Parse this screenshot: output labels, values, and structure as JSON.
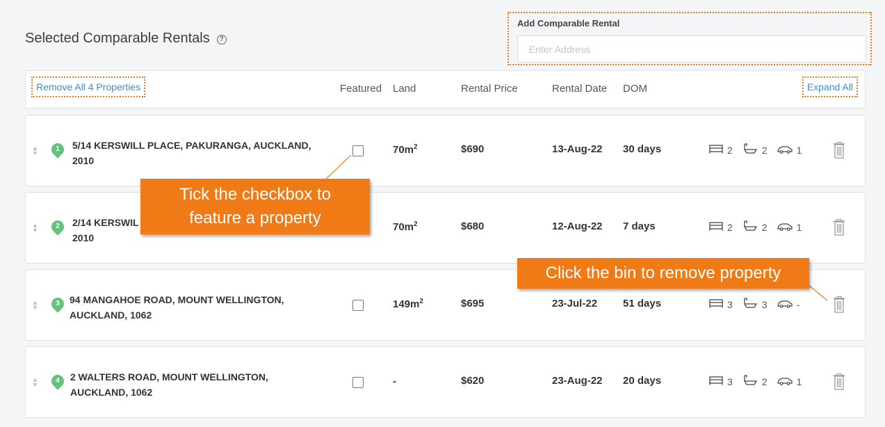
{
  "title": "Selected Comparable Rentals",
  "add_rental": {
    "label": "Add Comparable Rental",
    "placeholder": "Enter Address"
  },
  "header": {
    "remove_all_label": "Remove All 4 Properties",
    "expand_all_label": "Expand All",
    "columns": {
      "featured": "Featured",
      "land": "Land",
      "price": "Rental Price",
      "date": "Rental Date",
      "dom": "DOM"
    }
  },
  "properties": [
    {
      "num": "1",
      "address_line1": "5/14 KERSWILL PLACE, PAKURANGA, AUCKLAND,",
      "address_line2": "2010",
      "land": "70m",
      "land_sup": "2",
      "price": "$690",
      "date": "13-Aug-22",
      "dom": "30 days",
      "beds": "2",
      "baths": "2",
      "cars": "1"
    },
    {
      "num": "2",
      "address_line1": "2/14 KERSWIL",
      "address_line2": "2010",
      "land": "70m",
      "land_sup": "2",
      "price": "$680",
      "date": "12-Aug-22",
      "dom": "7 days",
      "beds": "2",
      "baths": "2",
      "cars": "1"
    },
    {
      "num": "3",
      "address_line1": "94 MANGAHOE ROAD, MOUNT WELLINGTON,",
      "address_line2": "AUCKLAND, 1062",
      "land": "149m",
      "land_sup": "2",
      "price": "$695",
      "date": "23-Jul-22",
      "dom": "51 days",
      "beds": "3",
      "baths": "3",
      "cars": "-"
    },
    {
      "num": "4",
      "address_line1": "2 WALTERS ROAD, MOUNT WELLINGTON,",
      "address_line2": "AUCKLAND, 1062",
      "land": "-",
      "land_sup": "",
      "price": "$620",
      "date": "23-Aug-22",
      "dom": "20 days",
      "beds": "3",
      "baths": "2",
      "cars": "1"
    }
  ],
  "callouts": {
    "checkbox_line1": "Tick the checkbox to",
    "checkbox_line2": "feature a property",
    "bin": "Click the bin to remove property"
  },
  "colors": {
    "accent_orange": "#f07b16",
    "link_blue": "#3a8dde",
    "pin_green": "#64c27c"
  }
}
